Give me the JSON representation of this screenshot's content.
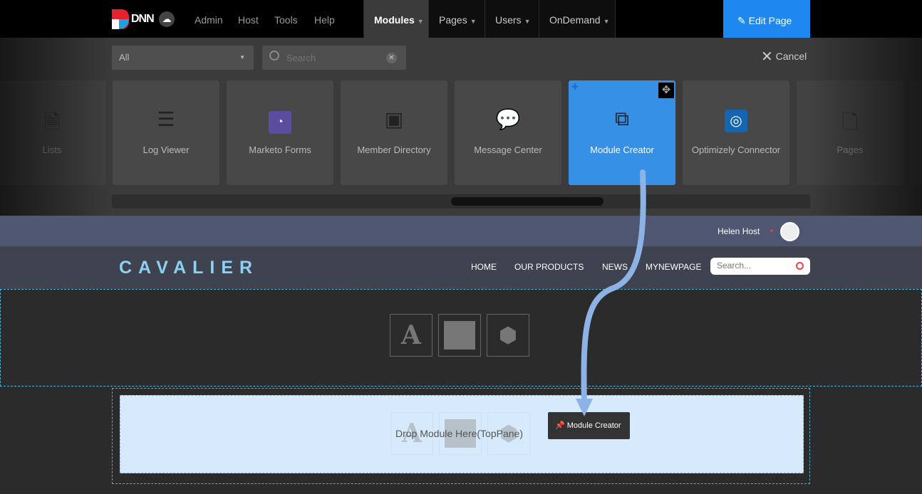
{
  "topbar": {
    "logo": "DNN",
    "menu": [
      "Admin",
      "Host",
      "Tools",
      "Help"
    ],
    "tabs": [
      "Modules",
      "Pages",
      "Users",
      "OnDemand"
    ],
    "edit_page": "Edit Page"
  },
  "panel": {
    "filter": "All",
    "search_placeholder": "Search",
    "cancel": "Cancel",
    "cards": [
      {
        "label": "Lists",
        "icon": "list-doc-icon"
      },
      {
        "label": "Log Viewer",
        "icon": "list-icon"
      },
      {
        "label": "Marketo Forms",
        "icon": "marketo-icon"
      },
      {
        "label": "Member Directory",
        "icon": "contact-book-icon"
      },
      {
        "label": "Message Center",
        "icon": "chat-icon"
      },
      {
        "label": "Module Creator",
        "icon": "window-edit-icon"
      },
      {
        "label": "Optimizely Connector",
        "icon": "optimizely-icon"
      },
      {
        "label": "Pages",
        "icon": "page-icon"
      }
    ]
  },
  "user": {
    "name": "Helen Host"
  },
  "site": {
    "logo": "CAVALIER",
    "nav": [
      "HOME",
      "OUR PRODUCTS",
      "NEWS",
      "MYNEWPAGE"
    ],
    "search_placeholder": "Search..."
  },
  "drop": {
    "text": "Drop Module Here(TopPane)",
    "drag_label": "Module Creator"
  },
  "colors": {
    "accent": "#1e88f0",
    "selected_card": "#3590e6",
    "drop_bg": "#d6eafc"
  }
}
